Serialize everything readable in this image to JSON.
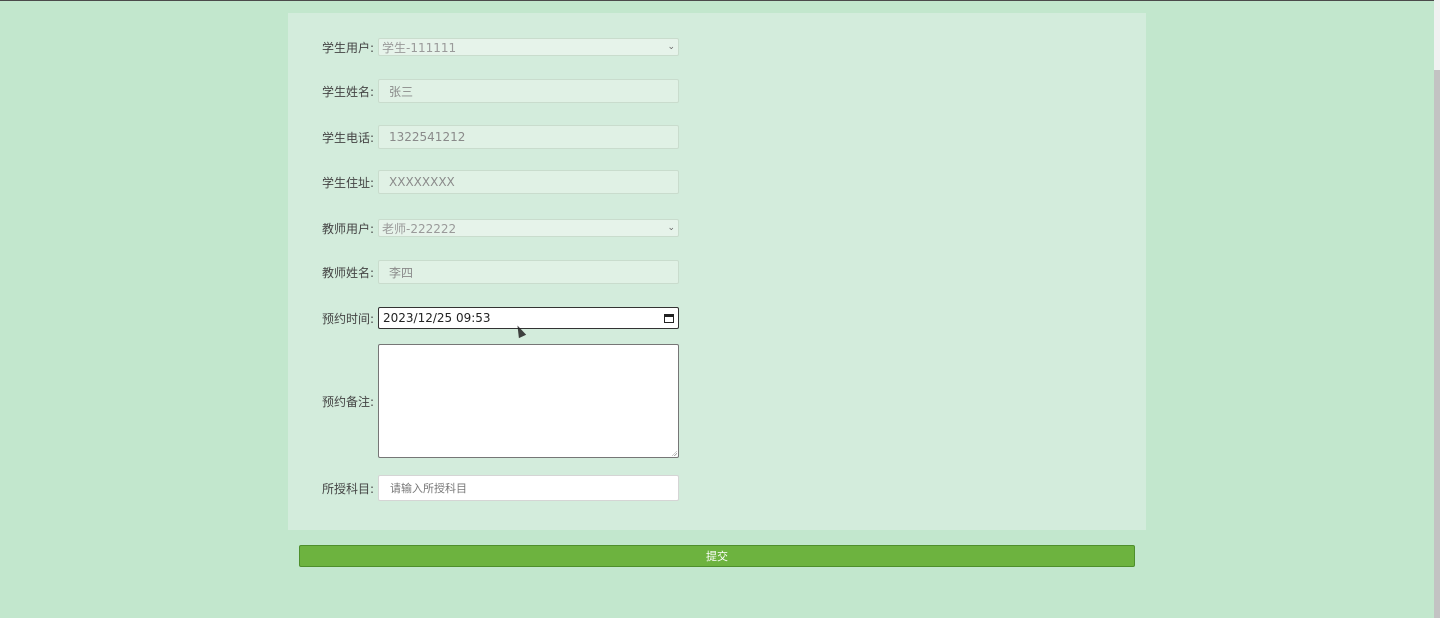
{
  "form": {
    "student_user": {
      "label": "学生用户:",
      "value": "学生-111111"
    },
    "student_name": {
      "label": "学生姓名:",
      "value": "张三"
    },
    "student_phone": {
      "label": "学生电话:",
      "value": "1322541212"
    },
    "student_address": {
      "label": "学生住址:",
      "value": "XXXXXXXX"
    },
    "teacher_user": {
      "label": "教师用户:",
      "value": "老师-222222"
    },
    "teacher_name": {
      "label": "教师姓名:",
      "value": "李四"
    },
    "appointment_time": {
      "label": "预约时间:",
      "value": "2023/12/25 09:53"
    },
    "appointment_note": {
      "label": "预约备注:",
      "value": ""
    },
    "subject": {
      "label": "所授科目:",
      "placeholder": "请输入所授科目"
    }
  },
  "submit_label": "提交",
  "colors": {
    "page_bg": "#c2e7cd",
    "panel_bg": "#d3ecdc",
    "submit_bg": "#6db33f"
  }
}
